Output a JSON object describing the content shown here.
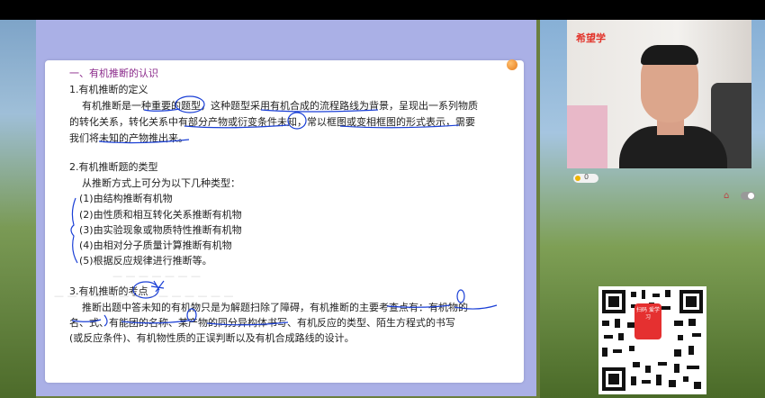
{
  "video": {
    "brand": "希望学",
    "likes": "0"
  },
  "slide": {
    "section_title": "一、有机推断的认识",
    "h1": "1.有机推断的定义",
    "p1_line1": "有机推断是一种重要的题型，这种题型采用有机合成的流程路线为背景，呈现出一系列物质",
    "p1_line2": "的转化关系，转化关系中有部分产物或衍变条件未知，常以框图或变相框图的形式表示，需要",
    "p1_line3": "我们将未知的产物推出来。",
    "h2": "2.有机推断题的类型",
    "p2_intro": "从推断方式上可分为以下几种类型：",
    "types": [
      "(1)由结构推断有机物",
      "(2)由性质和相互转化关系推断有机物",
      "(3)由实验现象或物质特性推断有机物",
      "(4)由相对分子质量计算推断有机物",
      "(5)根据反应规律进行推断等。"
    ],
    "h3": "3.有机推断的考点",
    "p3_line1": "推断出题中答未知的有机物只是为解题扫除了障碍，有机推断的主要考查点有：有机物的",
    "p3_line2": "名、式、有能团的名称、某产物的同分异构体书写、有机反应的类型、陌生方程式的书写",
    "p3_line3": "(或反应条件)、有机物性质的正误判断以及有机合成路线的设计。"
  },
  "qr": {
    "badge": "扫码 爱学习"
  },
  "colors": {
    "accent": "#8b2a8b",
    "ink": "#1a3fd6",
    "slide_bg": "#aab0e6"
  }
}
